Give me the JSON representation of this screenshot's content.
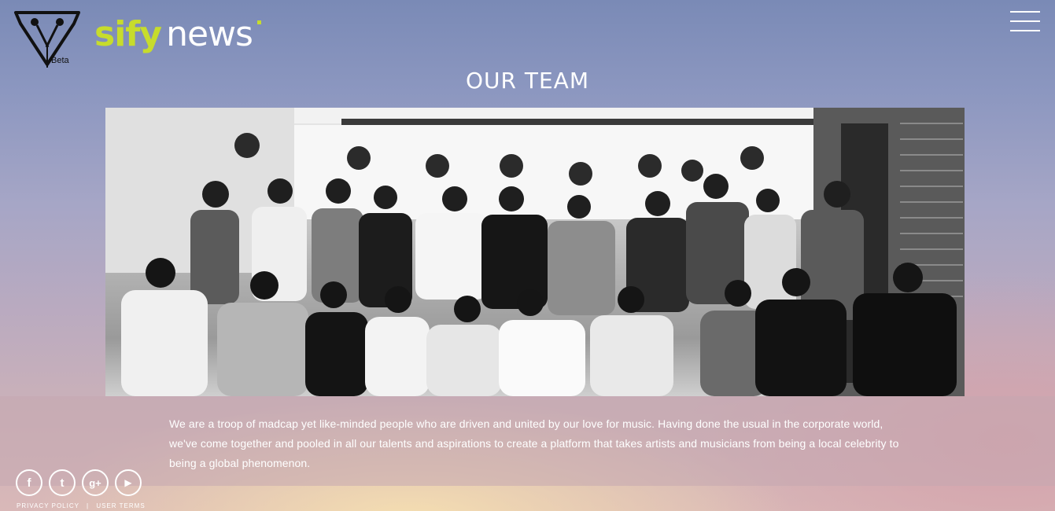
{
  "header": {
    "beta_label": "Beta",
    "brand_sify": "sify",
    "brand_news": "news",
    "menu_icon": "hamburger-menu-icon"
  },
  "main": {
    "title": "OUR TEAM",
    "photo_alt": "team-group-photo",
    "about": "We are a troop of madcap yet like-minded people who are driven and united by our love for music. Having done the usual in the corporate world, we've come together and pooled in all our talents and aspirations to create a platform that takes artists and musicians from being a local celebrity to being a global phenomenon."
  },
  "social": [
    {
      "icon": "facebook-icon",
      "glyph": "f"
    },
    {
      "icon": "twitter-icon",
      "glyph": "t"
    },
    {
      "icon": "google-plus-icon",
      "glyph": "g+"
    },
    {
      "icon": "youtube-icon",
      "glyph": "▶"
    }
  ],
  "footer": {
    "privacy": "PRIVACY POLICY",
    "separator": "|",
    "terms": "USER TERMS"
  },
  "colors": {
    "brand_green": "#c7dc2c",
    "text_white": "#ffffff"
  }
}
